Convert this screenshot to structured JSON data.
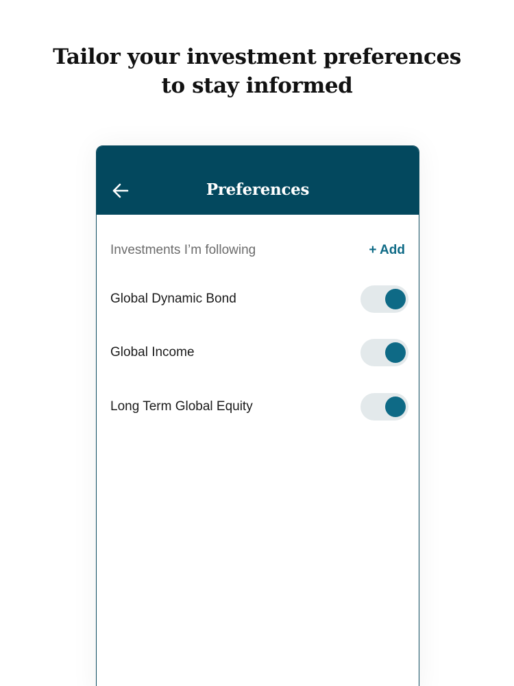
{
  "headline": {
    "line1": "Tailor your investment preferences",
    "line2": "to stay informed"
  },
  "appbar": {
    "back_icon": "arrow-left-icon",
    "title": "Preferences"
  },
  "section": {
    "label": "Investments I’m following",
    "add_label": "+ Add"
  },
  "investments": [
    {
      "name": "Global Dynamic Bond",
      "following": true
    },
    {
      "name": "Global Income",
      "following": true
    },
    {
      "name": "Long Term Global Equity",
      "following": true
    }
  ],
  "colors": {
    "appbar": "#03485e",
    "accent": "#0e6a86",
    "toggle_track": "#e3e9eb",
    "secondary_text": "#6b6b6b"
  }
}
